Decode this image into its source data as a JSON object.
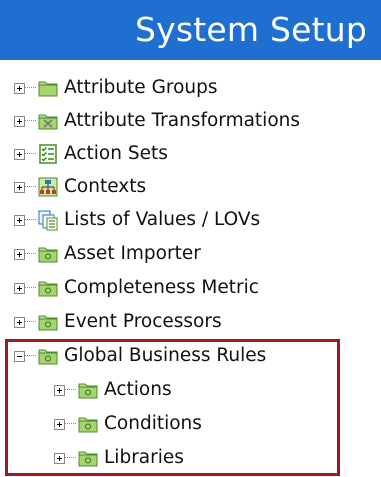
{
  "header": {
    "title": "System Setup",
    "background": "#1f6fd0"
  },
  "tree": {
    "items": [
      {
        "label": "Attribute Groups",
        "icon": "folder-icon",
        "expander": "plus"
      },
      {
        "label": "Attribute Transformations",
        "icon": "transformation-folder-icon",
        "expander": "plus"
      },
      {
        "label": "Action Sets",
        "icon": "checklist-icon",
        "expander": "plus"
      },
      {
        "label": "Contexts",
        "icon": "hierarchy-icon",
        "expander": "plus"
      },
      {
        "label": "Lists of Values / LOVs",
        "icon": "list-of-values-icon",
        "expander": "plus"
      },
      {
        "label": "Asset Importer",
        "icon": "folder-icon",
        "expander": "plus"
      },
      {
        "label": "Completeness Metric",
        "icon": "folder-icon",
        "expander": "plus"
      },
      {
        "label": "Event Processors",
        "icon": "folder-icon",
        "expander": "plus"
      },
      {
        "label": "Global Business Rules",
        "icon": "folder-icon",
        "expander": "minus"
      }
    ],
    "children": [
      {
        "label": "Actions",
        "icon": "folder-icon",
        "expander": "plus"
      },
      {
        "label": "Conditions",
        "icon": "folder-icon",
        "expander": "plus"
      },
      {
        "label": "Libraries",
        "icon": "folder-icon",
        "expander": "plus"
      }
    ]
  },
  "highlight_color": "#9a1b1b"
}
